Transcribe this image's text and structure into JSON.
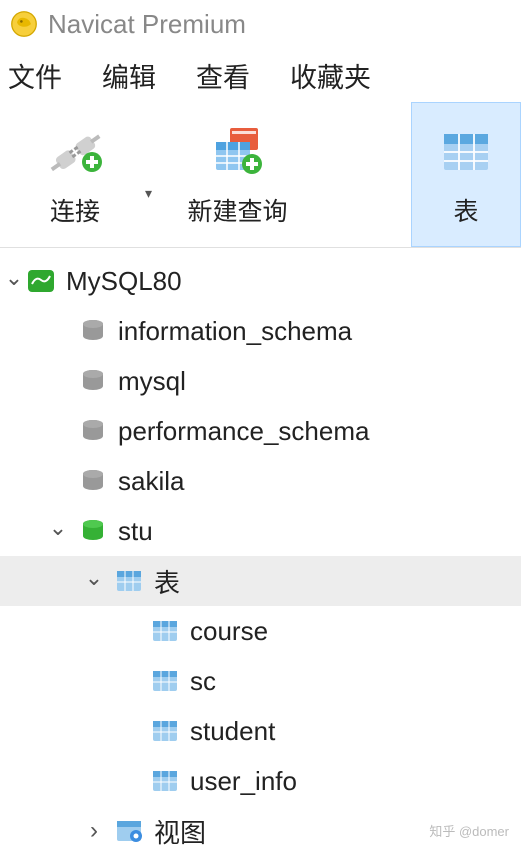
{
  "app": {
    "title": "Navicat Premium"
  },
  "menu": {
    "file": "文件",
    "edit": "编辑",
    "view": "查看",
    "favorites": "收藏夹"
  },
  "toolbar": {
    "connect": "连接",
    "new_query": "新建查询",
    "table": "表"
  },
  "tree": {
    "connection": "MySQL80",
    "databases": {
      "information_schema": "information_schema",
      "mysql": "mysql",
      "performance_schema": "performance_schema",
      "sakila": "sakila",
      "stu": "stu"
    },
    "groups": {
      "tables": "表",
      "views": "视图"
    },
    "tables": {
      "course": "course",
      "sc": "sc",
      "student": "student",
      "user_info": "user_info"
    }
  },
  "watermark": "知乎 @domer"
}
